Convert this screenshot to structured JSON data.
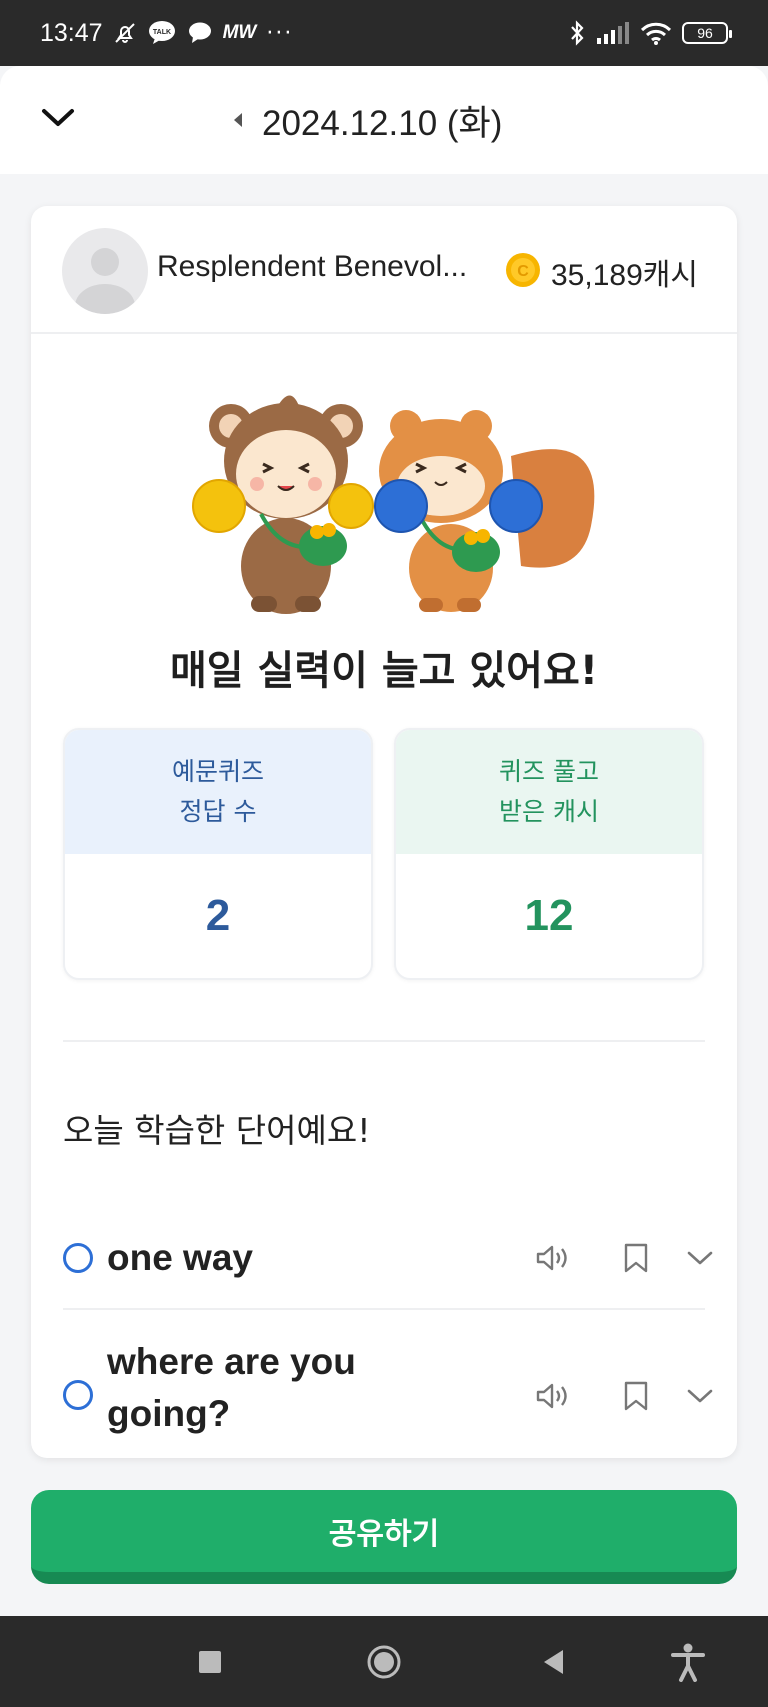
{
  "status_bar": {
    "time": "13:47",
    "kakao_label": "TALK",
    "mw_label": "MW",
    "more": "···",
    "battery": "96"
  },
  "header": {
    "date": "2024.12.10 (화)"
  },
  "profile": {
    "name": "Resplendent Benevol...",
    "cash": "35,189캐시"
  },
  "headline": "매일 실력이 늘고 있어요!",
  "stats": [
    {
      "label_line1": "예문퀴즈",
      "label_line2": "정답 수",
      "value": "2"
    },
    {
      "label_line1": "퀴즈 풀고",
      "label_line2": "받은 캐시",
      "value": "12"
    }
  ],
  "words_title": "오늘 학습한 단어예요!",
  "words": [
    {
      "text": "one way"
    },
    {
      "text": "where are you going?"
    }
  ],
  "share_button": "공유하기",
  "colors": {
    "accent_green": "#1fae6a",
    "accent_blue": "#2d5a9b",
    "circle_blue": "#2d6fd6"
  }
}
